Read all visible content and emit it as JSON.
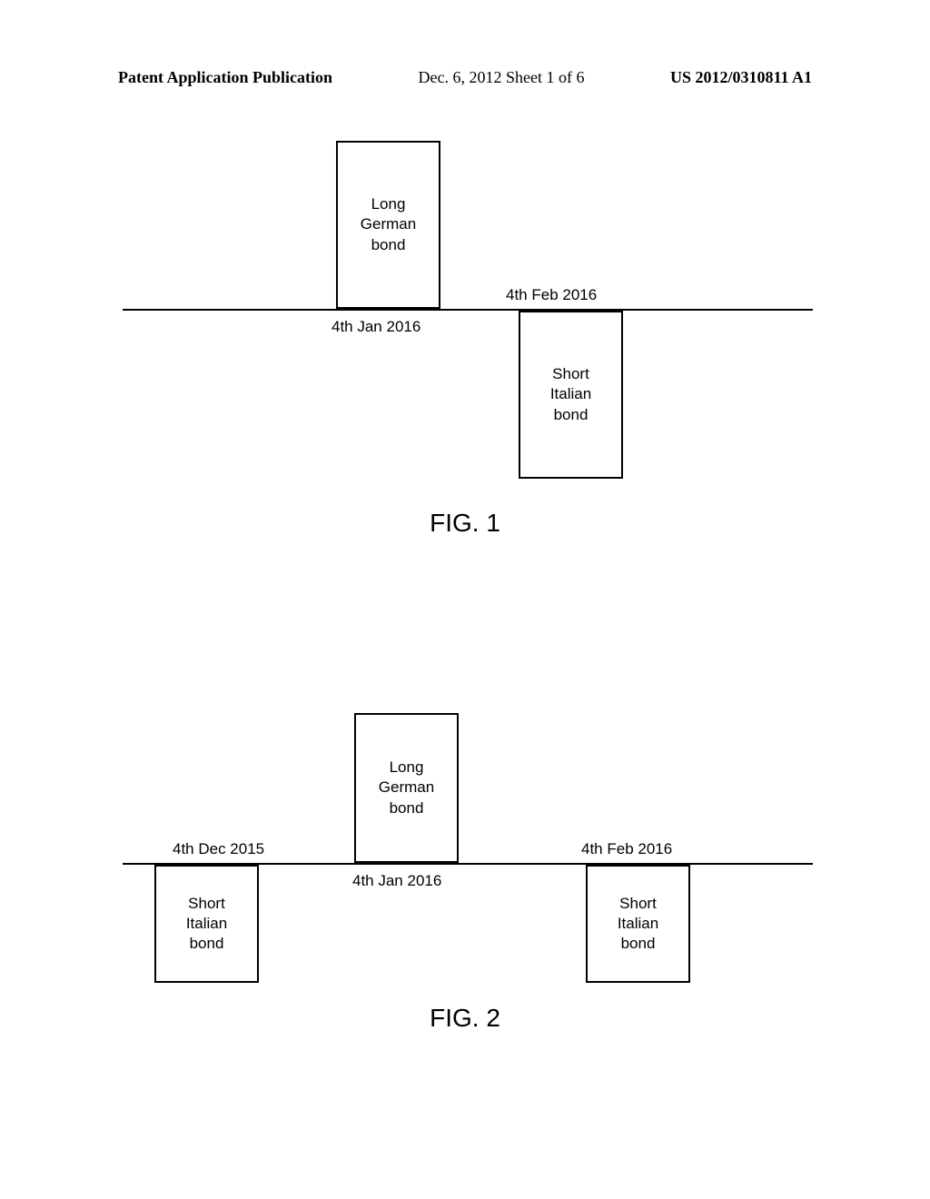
{
  "header": {
    "left": "Patent Application Publication",
    "center": "Dec. 6, 2012   Sheet 1 of 6",
    "right": "US 2012/0310811 A1"
  },
  "figure1": {
    "long_german": "Long\nGerman\nbond",
    "short_italian": "Short\nItalian\nbond",
    "date1": "4th Jan 2016",
    "date2": "4th Feb 2016",
    "caption": "FIG. 1"
  },
  "figure2": {
    "long_german": "Long\nGerman\nbond",
    "short_italian_left": "Short\nItalian\nbond",
    "short_italian_right": "Short\nItalian\nbond",
    "date1": "4th Dec 2015",
    "date2": "4th Jan 2016",
    "date3": "4th Feb 2016",
    "caption": "FIG. 2"
  }
}
